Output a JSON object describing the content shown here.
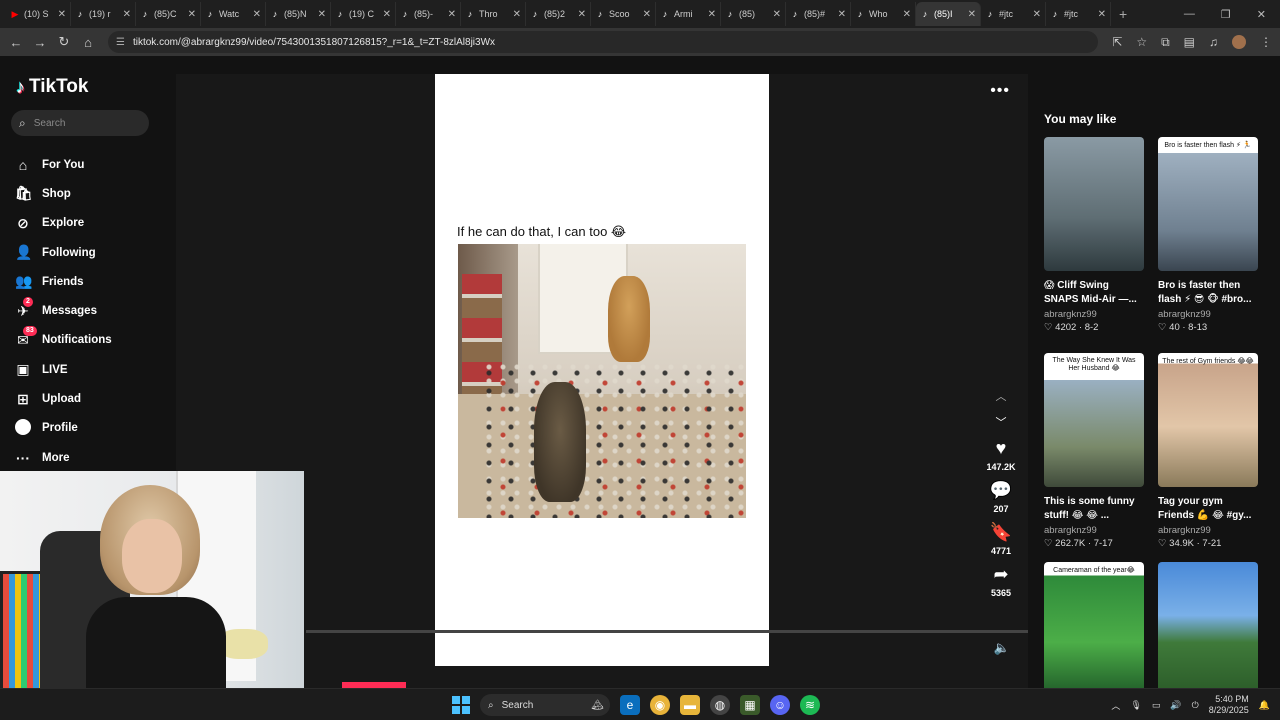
{
  "browser": {
    "tabs": [
      {
        "title": "(10) S",
        "color": "#ff0000",
        "active": false
      },
      {
        "title": "(19) r",
        "color": "#ffffff",
        "active": false
      },
      {
        "title": "(85)C",
        "color": "#ffffff",
        "active": false
      },
      {
        "title": "Watc",
        "color": "#ffffff",
        "active": false
      },
      {
        "title": "(85)N",
        "color": "#ffffff",
        "active": false
      },
      {
        "title": "(19) C",
        "color": "#ffffff",
        "active": false
      },
      {
        "title": "(85)-",
        "color": "#ffffff",
        "active": false
      },
      {
        "title": "Thro",
        "color": "#ffffff",
        "active": false
      },
      {
        "title": "(85)2",
        "color": "#ffffff",
        "active": false
      },
      {
        "title": "Scoo",
        "color": "#ffffff",
        "active": false
      },
      {
        "title": "Armi",
        "color": "#ffffff",
        "active": false
      },
      {
        "title": "(85)",
        "color": "#ffffff",
        "active": false
      },
      {
        "title": "(85)#",
        "color": "#ffffff",
        "active": false
      },
      {
        "title": "Who",
        "color": "#ffffff",
        "active": false
      },
      {
        "title": "(85)I",
        "color": "#ffffff",
        "active": true
      },
      {
        "title": "#jtc",
        "color": "#ffffff",
        "active": false
      },
      {
        "title": "#jtc",
        "color": "#ffffff",
        "active": false
      }
    ],
    "url": "tiktok.com/@abrargknz99/video/7543001351807126815?_r=1&_t=ZT-8zlAl8ji3Wx"
  },
  "sidebar": {
    "logo": "TikTok",
    "search_placeholder": "Search",
    "items": [
      {
        "label": "For You",
        "icon": "⌂",
        "badge": ""
      },
      {
        "label": "Shop",
        "icon": "🛍",
        "badge": ""
      },
      {
        "label": "Explore",
        "icon": "⊘",
        "badge": ""
      },
      {
        "label": "Following",
        "icon": "👤",
        "badge": ""
      },
      {
        "label": "Friends",
        "icon": "👥",
        "badge": ""
      },
      {
        "label": "Messages",
        "icon": "✈",
        "badge": "2"
      },
      {
        "label": "Notifications",
        "icon": "✉",
        "badge": "83"
      },
      {
        "label": "LIVE",
        "icon": "▣",
        "badge": ""
      },
      {
        "label": "Upload",
        "icon": "⊞",
        "badge": ""
      },
      {
        "label": "Profile",
        "icon": "",
        "badge": ""
      },
      {
        "label": "More",
        "icon": "···",
        "badge": ""
      }
    ]
  },
  "video": {
    "caption": "If he can do that, I can too 😂",
    "likes": "147.2K",
    "comments": "207",
    "saves": "4771",
    "shares": "5365"
  },
  "right_panel": {
    "title": "You may like",
    "cards": [
      {
        "title": "😱 Cliff Swing SNAPS Mid-Air —...",
        "author": "abrargknz99",
        "stats": "♡ 4202 · 8-2",
        "thumb_text": "",
        "bg": "linear-gradient(180deg,#8a9aa4,#5f6e74 60%,#2e3a3e)"
      },
      {
        "title": "Bro is faster then flash ⚡ 😎 🐵 #bro...",
        "author": "abrargknz99",
        "stats": "♡ 40 · 8-13",
        "thumb_text": "Bro is faster then flash ⚡ 🏃",
        "bg": "linear-gradient(180deg,#ffffff 0%,#ffffff 12%,#9fb0c0 12%,#6f8090 70%,#3a4550)"
      },
      {
        "title": "This is some funny stuff! 😂 😂 ...",
        "author": "abrargknz99",
        "stats": "♡ 262.7K · 7-17",
        "thumb_text": "The Way She Knew It Was Her Husband 😂",
        "bg": "linear-gradient(180deg,#ffffff 0%,#ffffff 20%,#9ab0c2 20%,#7a8a6a 70%,#3f4a3a)"
      },
      {
        "title": "Tag your gym Friends 💪 😂 #gy...",
        "author": "abrargknz99",
        "stats": "♡ 34.9K · 7-21",
        "thumb_text": "The rest of Gym friends 😂😂",
        "bg": "linear-gradient(180deg,#ffffff 0%,#ffffff 8%,#c8a48a 8%,#e2c6a8 55%,#8a7a5a)"
      },
      {
        "title": "",
        "author": "",
        "stats": "",
        "thumb_text": "Cameraman of the year😂",
        "bg": "linear-gradient(180deg,#ffffff 0%,#ffffff 10%,#2e8a3a 10%,#4cae48 60%,#1f5a28)"
      },
      {
        "title": "",
        "author": "",
        "stats": "",
        "thumb_text": "",
        "bg": "linear-gradient(180deg,#4a8ad8 0%,#7ab0e8 40%,#3f7a3a 60%,#2a5a28)"
      }
    ]
  },
  "taskbar": {
    "search_label": "Search",
    "time": "5:40 PM",
    "date": "8/29/2025"
  }
}
